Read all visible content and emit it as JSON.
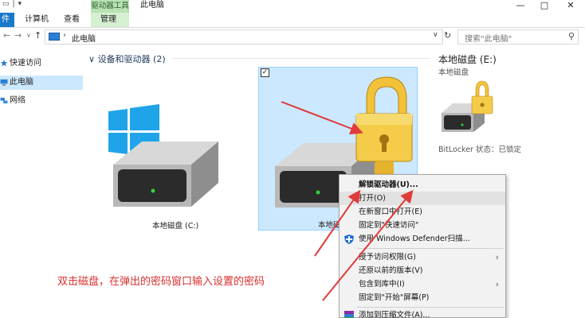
{
  "titlebar": {
    "context_tab": "驱动器工具",
    "title": "此电脑",
    "minimize": "—",
    "maximize": "□",
    "close": "✕"
  },
  "ribbon": {
    "tabs": [
      {
        "label": "件"
      },
      {
        "label": "计算机"
      },
      {
        "label": "查看"
      },
      {
        "label": "管理"
      }
    ]
  },
  "addressbar": {
    "path": "此电脑",
    "search_placeholder": "搜索\"此电脑\""
  },
  "sidebar": {
    "items": [
      {
        "label": "快速访问"
      },
      {
        "label": "此电脑"
      },
      {
        "label": "网络"
      }
    ]
  },
  "main": {
    "group_header": "设备和驱动器 (2)",
    "drives": [
      {
        "label": "本地磁盘 (C:)"
      },
      {
        "label": "本地磁"
      }
    ]
  },
  "details": {
    "title": "本地磁盘 (E:)",
    "subtitle": "本地磁盘",
    "status": "BitLocker 状态：已锁定"
  },
  "context_menu": {
    "items": [
      {
        "label": "解锁驱动器(U)..."
      },
      {
        "label": "打开(O)"
      },
      {
        "label": "在新窗口中打开(E)"
      },
      {
        "label": "固定到\"快速访问\""
      },
      {
        "label": "使用 Windows Defender扫描..."
      },
      {
        "label": "授予访问权限(G)"
      },
      {
        "label": "还原以前的版本(V)"
      },
      {
        "label": "包含到库中(I)"
      },
      {
        "label": "固定到\"开始\"屏幕(P)"
      },
      {
        "label": "添加到压缩文件(A)..."
      }
    ]
  },
  "annotation": {
    "text": "双击磁盘，在弹出的密码窗口输入设置的密码"
  },
  "colors": {
    "accent": "#1979ca",
    "selection": "#cce8ff",
    "context_tab": "#b9e3b4",
    "annotation": "#d93030",
    "arrow": "#e03a3a"
  },
  "icons": [
    "windows-logo-icon",
    "padlock-icon",
    "hard-drive-icon",
    "defender-shield-icon",
    "winrar-icon",
    "pc-icon",
    "network-icon",
    "star-icon"
  ]
}
